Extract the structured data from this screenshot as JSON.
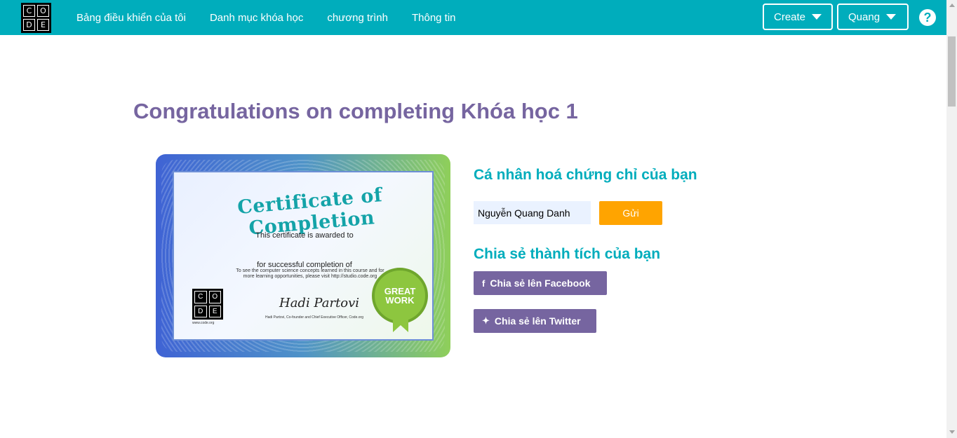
{
  "header": {
    "logo_letters": [
      "C",
      "O",
      "D",
      "E"
    ],
    "nav": [
      {
        "label": "Bảng điều khiển của tôi"
      },
      {
        "label": "Danh mục khóa học"
      },
      {
        "label": "chương trình"
      },
      {
        "label": "Thông tin"
      }
    ],
    "create_label": "Create",
    "user_label": "Quang",
    "help_label": "?"
  },
  "colors": {
    "header": "#00adbc",
    "title": "#7665a0",
    "accent": "#00adbc",
    "send": "#ffa400",
    "share": "#7665a0"
  },
  "main": {
    "title": "Congratulations on completing Khóa học 1",
    "certificate": {
      "heading": "Certificate of Completion",
      "awarded": "This certificate is awarded to",
      "completion": "for successful completion of",
      "small_text": "To see the computer science concepts learned in this course and for more learning opportunities, please visit http://studio.code.org",
      "website": "www.code.org",
      "signature": "Hadi Partovi",
      "signer": "Hadi Partovi, Co-founder and Chief Executive Officer, Code.org",
      "seal_text": "GREAT WORK"
    },
    "personalize": {
      "heading": "Cá nhân hoá chứng chỉ của bạn",
      "name_value": "Nguyễn Quang Danh",
      "send_label": "Gửi"
    },
    "share": {
      "heading": "Chia sẻ thành tích của bạn",
      "facebook_label": "Chia sẻ lên Facebook",
      "twitter_label": "Chia sẻ lên Twitter"
    }
  }
}
